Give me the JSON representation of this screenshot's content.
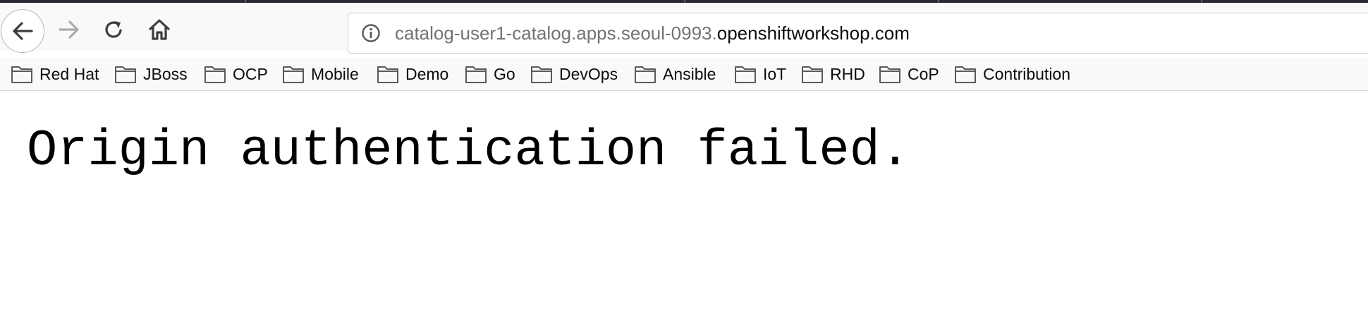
{
  "browser": {
    "nav": {
      "back_icon": "arrow-left-icon",
      "forward_icon": "arrow-right-icon",
      "reload_icon": "reload-icon",
      "home_icon": "home-icon"
    },
    "url": {
      "info_icon": "info-icon",
      "prefix": "catalog-user1-catalog.apps.seoul-0993.",
      "domain": "openshiftworkshop.com"
    },
    "bookmarks": [
      {
        "label": "Red Hat",
        "icon": "folder-icon"
      },
      {
        "label": "JBoss",
        "icon": "folder-icon"
      },
      {
        "label": "OCP",
        "icon": "folder-icon"
      },
      {
        "label": "Mobile",
        "icon": "folder-icon"
      },
      {
        "label": "Demo",
        "icon": "folder-icon"
      },
      {
        "label": "Go",
        "icon": "folder-icon"
      },
      {
        "label": "DevOps",
        "icon": "folder-icon"
      },
      {
        "label": "Ansible",
        "icon": "folder-icon"
      },
      {
        "label": "IoT",
        "icon": "folder-icon"
      },
      {
        "label": "RHD",
        "icon": "folder-icon"
      },
      {
        "label": "CoP",
        "icon": "folder-icon"
      },
      {
        "label": "Contribution",
        "icon": "folder-icon"
      }
    ]
  },
  "page": {
    "message": "Origin authentication failed."
  },
  "colors": {
    "toolbar_bg": "#f9f9fa",
    "url_prefix": "#737373",
    "url_domain": "#0c0c0d",
    "tabstrip": "#2b2a33"
  }
}
